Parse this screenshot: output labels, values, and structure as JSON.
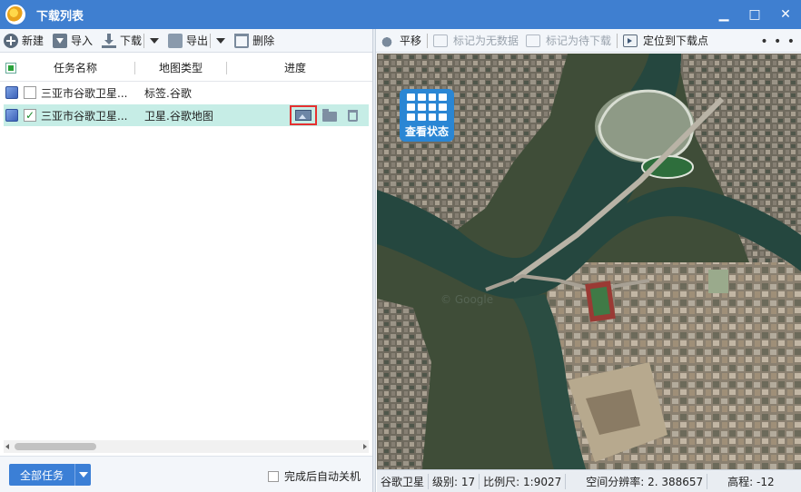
{
  "window": {
    "title": "下载列表",
    "controls": {
      "minimize": "▁",
      "maximize": "□",
      "close": "✕"
    }
  },
  "left_toolbar": {
    "new_label": "新建",
    "import_label": "导入",
    "download_label": "下载",
    "export_label": "导出",
    "delete_label": "删除"
  },
  "table": {
    "columns": [
      "任务名称",
      "地图类型",
      "进度"
    ],
    "rows": [
      {
        "name": "三亚市谷歌卫星...",
        "type": "标签.谷歌",
        "checked": false,
        "selected": false
      },
      {
        "name": "三亚市谷歌卫星...",
        "type": "卫星.谷歌地图",
        "checked": true,
        "selected": true
      }
    ]
  },
  "bottom": {
    "all_tasks_label": "全部任务",
    "auto_shutdown_label": "完成后自动关机"
  },
  "right_toolbar": {
    "pan_label": "平移",
    "mark_no_data_label": "标记为无数据",
    "mark_pending_label": "标记为待下载",
    "locate_label": "定位到下载点",
    "more_label": "• • •"
  },
  "map": {
    "view_status_label": "查看状态",
    "watermark": "© Google"
  },
  "status_bar": {
    "source": "谷歌卫星",
    "level": "级别: 17",
    "scale": "比例尺: 1:9027",
    "resolution": "空间分辨率: 2. 388657",
    "elevation": "高程: -12"
  },
  "colors": {
    "title_bar": "#3f7fd0",
    "selected_row": "#c6ede6",
    "primary_button": "#3b7fd6",
    "highlight_box": "#e53030",
    "river": "#25473f"
  }
}
